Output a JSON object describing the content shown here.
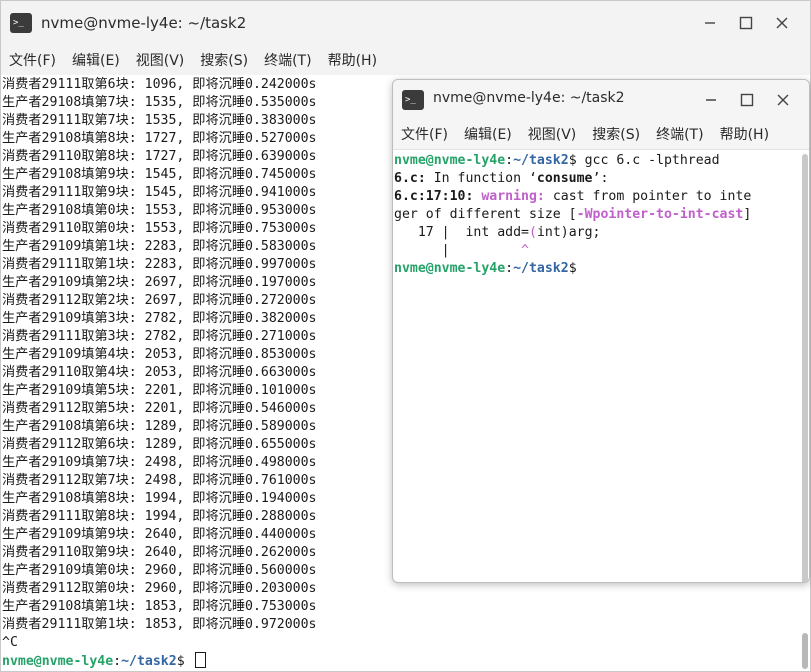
{
  "back_window": {
    "title": "nvme@nvme-ly4e: ~/task2",
    "menu": [
      "文件(F)",
      "编辑(E)",
      "视图(V)",
      "搜索(S)",
      "终端(T)",
      "帮助(H)"
    ],
    "lines": [
      "消费者29111取第6块: 1096, 即将沉睡0.242000s",
      "生产者29108填第7块: 1535, 即将沉睡0.535000s",
      "消费者29111取第7块: 1535, 即将沉睡0.383000s",
      "生产者29108填第8块: 1727, 即将沉睡0.527000s",
      "消费者29110取第8块: 1727, 即将沉睡0.639000s",
      "生产者29108填第9块: 1545, 即将沉睡0.745000s",
      "消费者29111取第9块: 1545, 即将沉睡0.941000s",
      "生产者29108填第0块: 1553, 即将沉睡0.953000s",
      "消费者29110取第0块: 1553, 即将沉睡0.753000s",
      "生产者29109填第1块: 2283, 即将沉睡0.583000s",
      "消费者29111取第1块: 2283, 即将沉睡0.997000s",
      "生产者29109填第2块: 2697, 即将沉睡0.197000s",
      "消费者29112取第2块: 2697, 即将沉睡0.272000s",
      "生产者29109填第3块: 2782, 即将沉睡0.382000s",
      "消费者29111取第3块: 2782, 即将沉睡0.271000s",
      "生产者29109填第4块: 2053, 即将沉睡0.853000s",
      "消费者29110取第4块: 2053, 即将沉睡0.663000s",
      "生产者29109填第5块: 2201, 即将沉睡0.101000s",
      "消费者29112取第5块: 2201, 即将沉睡0.546000s",
      "生产者29108填第6块: 1289, 即将沉睡0.589000s",
      "消费者29112取第6块: 1289, 即将沉睡0.655000s",
      "生产者29109填第7块: 2498, 即将沉睡0.498000s",
      "消费者29112取第7块: 2498, 即将沉睡0.761000s",
      "生产者29108填第8块: 1994, 即将沉睡0.194000s",
      "消费者29111取第8块: 1994, 即将沉睡0.288000s",
      "生产者29109填第9块: 2640, 即将沉睡0.440000s",
      "消费者29110取第9块: 2640, 即将沉睡0.262000s",
      "生产者29109填第0块: 2960, 即将沉睡0.560000s",
      "消费者29112取第0块: 2960, 即将沉睡0.203000s",
      "生产者29108填第1块: 1853, 即将沉睡0.753000s",
      "消费者29111取第1块: 1853, 即将沉睡0.972000s",
      "^C"
    ],
    "prompt_user": "nvme@nvme-ly4e",
    "prompt_sep": ":",
    "prompt_path": "~/task2",
    "prompt_dollar": "$ "
  },
  "front_window": {
    "title": "nvme@nvme-ly4e: ~/task2",
    "menu": [
      "文件(F)",
      "编辑(E)",
      "视图(V)",
      "搜索(S)",
      "终端(T)",
      "帮助(H)"
    ],
    "prompt_user": "nvme@nvme-ly4e",
    "prompt_sep": ":",
    "prompt_path": "~/task2",
    "prompt_dollar": "$",
    "command": " gcc 6.c -lpthread",
    "line2_file": "6.c:",
    "line2_rest": " In function ‘",
    "line2_func": "consume",
    "line2_end": "’:",
    "line3_loc": "6.c:17:10:",
    "line3_warn": "warning:",
    "line3_rest": " cast from pointer to inte",
    "line4_rest": "ger of different size [",
    "line4_flag": "-Wpointer-to-int-cast",
    "line4_end": "]",
    "line5": "   17 |  int add=",
    "line5_paren": "(",
    "line5_rest": "int)arg;",
    "line6": "      |         ",
    "line6_caret": "^"
  },
  "colors": {
    "prompt_user": "#26a269",
    "prompt_path": "#3465a4",
    "warning": "#c061cb"
  },
  "icons": [
    "terminal-icon",
    "minimize-icon",
    "maximize-icon",
    "close-icon"
  ]
}
